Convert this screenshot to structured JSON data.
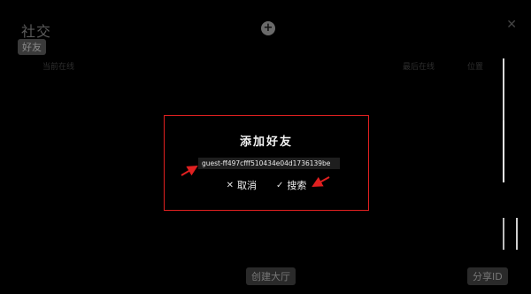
{
  "background": {
    "title": "社交",
    "tab_friends": "好友",
    "header_cols": [
      "当前在线",
      "最后在线",
      "位置"
    ],
    "bottom_buttons": {
      "create": "创建大厅",
      "share": "分享ID"
    }
  },
  "dialog": {
    "title": "添加好友",
    "input_value": "guest-ff497cfff510434e04d1736139be",
    "cancel_label": "取消",
    "search_label": "搜索"
  },
  "colors": {
    "dialog_border": "#e02020",
    "arrow": "#e02020"
  },
  "icons": {
    "plus": "plus-icon",
    "close": "close-icon",
    "cancel": "x-icon",
    "confirm": "check-icon"
  }
}
